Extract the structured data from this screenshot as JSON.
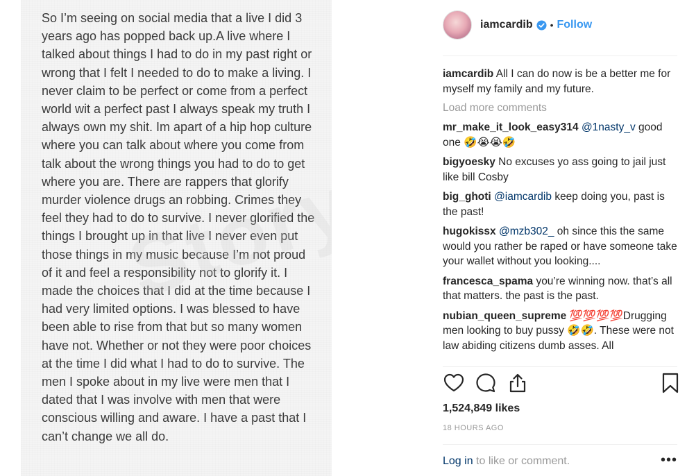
{
  "post": {
    "note_text": "So I’m seeing on social media that a live I did 3 years ago has popped back up.A live where I talked about things I had to do in my past right or wrong that I felt I needed to do to make a living. I never claim to be perfect or come from a perfect world wit a perfect past I always speak my truth I always own my shit. Im apart of a hip hop culture where you can talk about where you come from talk about the wrong things you had to do to get where you are. There are rappers that glorify murder violence drugs an robbing. Crimes they feel they had to do to survive. I never glorified the things I brought up in that live I never even put those things in my music because I’m not proud of it and feel a responsibility not to glorify it. I made the choices that I did at the time because I had very limited options. I was blessed to have been able to rise from that but so many women have not. Whether or not they were poor choices at the time I did what I had to do to survive. The men I spoke about in my live were men that I dated that I was involve with men that were conscious willing and aware. I have a past that I can’t change we all do.",
    "watermark": "Story.al"
  },
  "header": {
    "username": "iamcardib",
    "dot": "•",
    "follow_label": "Follow"
  },
  "caption": {
    "user": "iamcardib",
    "text": "All I can do now is be a better me for myself my family and my future."
  },
  "load_more_label": "Load more comments",
  "comments": [
    {
      "user": "mr_make_it_look_easy314",
      "mention": "@1nasty_v",
      "text": "good one 🤣😭😭🤣"
    },
    {
      "user": "bigyoesky",
      "mention": "",
      "text": "No excuses yo ass going to jail just like bill Cosby"
    },
    {
      "user": "big_ghoti",
      "mention": "@iamcardib",
      "text": "keep doing you, past is the past!"
    },
    {
      "user": "hugokissx",
      "mention": "@mzb302_",
      "text": "oh since this the same would you rather be raped or have someone take your wallet without you looking...."
    },
    {
      "user": "francesca_spama",
      "mention": "",
      "text": "you’re winning now. that’s all that matters. the past is the past."
    },
    {
      "user": "nubian_queen_supreme",
      "mention": "",
      "text": "💯💯💯💯Drugging men looking to buy pussy 🤣🤣. These were not law abiding citizens dumb asses. All"
    }
  ],
  "icons": {
    "like": "heart-icon",
    "comment": "comment-icon",
    "share": "share-icon",
    "save": "bookmark-icon",
    "verified": "verified-badge-icon",
    "more": "more-options-icon"
  },
  "likes_text": "1,524,849 likes",
  "time_ago": "18 HOURS AGO",
  "footer": {
    "login_label": "Log in",
    "rest": " to like or comment.",
    "more_label": "•••"
  },
  "colors": {
    "link_blue": "#3897f0",
    "mention_blue": "#003569",
    "muted": "#999999",
    "text": "#262626"
  }
}
